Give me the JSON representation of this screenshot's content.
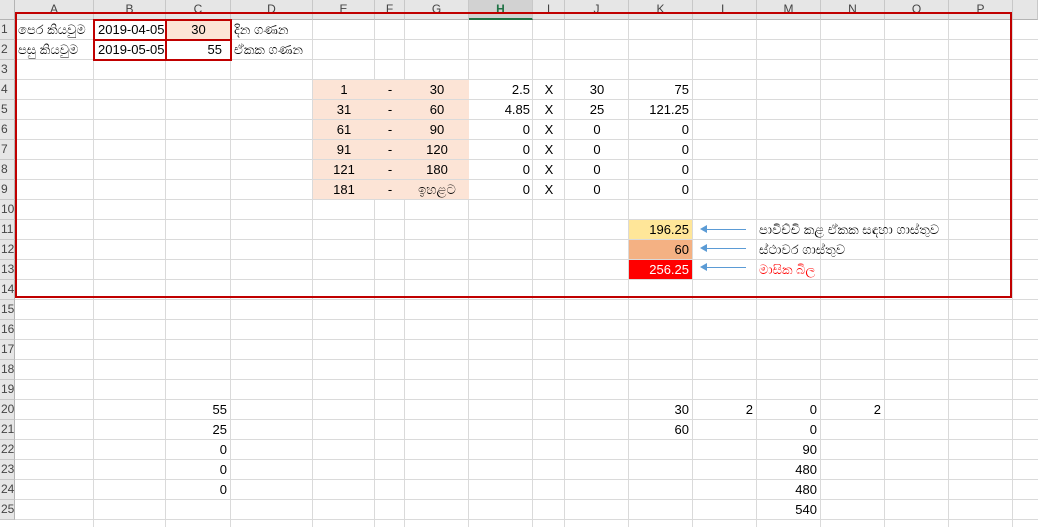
{
  "columns": [
    "A",
    "B",
    "C",
    "D",
    "E",
    "F",
    "G",
    "H",
    "I",
    "J",
    "K",
    "L",
    "M",
    "N",
    "O",
    "P"
  ],
  "selected_column": "H",
  "rows": [
    "1",
    "2",
    "3",
    "4",
    "5",
    "6",
    "7",
    "8",
    "9",
    "10",
    "11",
    "12",
    "13",
    "14",
    "15",
    "16",
    "17",
    "18",
    "19",
    "20",
    "21",
    "22",
    "23",
    "24",
    "25"
  ],
  "header_block": {
    "prev_reading_label": "පෙර කියවුම",
    "prev_reading_date": "2019-04-05",
    "day_count": "30",
    "day_count_label": "දින ගණන",
    "curr_reading_label": "පසු කියවුම",
    "curr_reading_date": "2019-05-05",
    "unit_count": "55",
    "unit_count_label": "ඒකක ගණන"
  },
  "tariff_rows": [
    {
      "from": "1",
      "dash": "-",
      "to": "30",
      "rate": "2.5",
      "x": "X",
      "units": "30",
      "amount": "75"
    },
    {
      "from": "31",
      "dash": "-",
      "to": "60",
      "rate": "4.85",
      "x": "X",
      "units": "25",
      "amount": "121.25"
    },
    {
      "from": "61",
      "dash": "-",
      "to": "90",
      "rate": "0",
      "x": "X",
      "units": "0",
      "amount": "0"
    },
    {
      "from": "91",
      "dash": "-",
      "to": "120",
      "rate": "0",
      "x": "X",
      "units": "0",
      "amount": "0"
    },
    {
      "from": "121",
      "dash": "-",
      "to": "180",
      "rate": "0",
      "x": "X",
      "units": "0",
      "amount": "0"
    },
    {
      "from": "181",
      "dash": "-",
      "to": "ඉහළට",
      "rate": "0",
      "x": "X",
      "units": "0",
      "amount": "0"
    }
  ],
  "totals": {
    "usage_charge": "196.25",
    "usage_charge_label": "පාවිච්චි කළ ඒකක සඳහා ගාස්තුව",
    "fixed_charge": "60",
    "fixed_charge_label": "ස්ථාවර ගාස්තුව",
    "monthly_bill": "256.25",
    "monthly_bill_label": "මාසික බිල"
  },
  "lower": {
    "C20": "55",
    "C21": "25",
    "C22": "0",
    "C23": "0",
    "C24": "0",
    "K20": "30",
    "K21": "60",
    "L20": "2",
    "M20": "0",
    "M21": "0",
    "M22": "90",
    "M23": "480",
    "M24": "480",
    "M25": "540",
    "N20": "2"
  },
  "colors": {
    "border_red": "#c00000",
    "peach_fill": "#fce4d6",
    "yellow_fill": "#ffe699",
    "orange_fill": "#f4b183",
    "red_fill": "#ff0000",
    "arrow_blue": "#5b9bd5",
    "selected_header": "#217346"
  }
}
